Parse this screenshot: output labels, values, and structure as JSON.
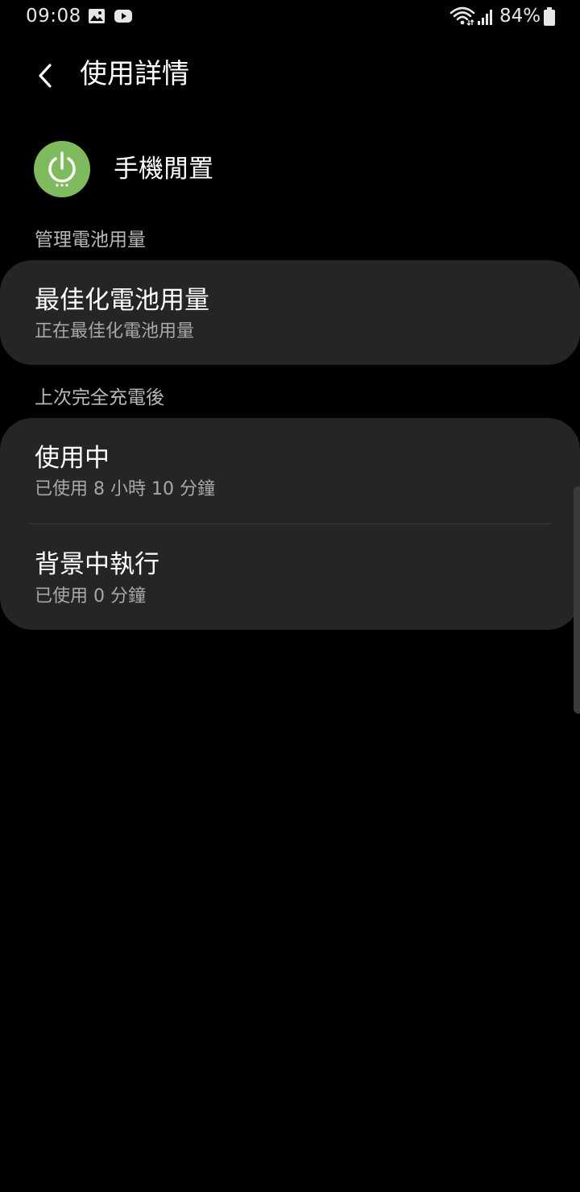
{
  "status_bar": {
    "time": "09:08",
    "notification_icons": [
      "image-icon",
      "youtube-icon"
    ],
    "wifi_icon": "wifi-icon",
    "signal_icon": "signal-icon",
    "battery_percent": "84%",
    "battery_icon": "battery-icon"
  },
  "header": {
    "back_icon": "chevron-left-icon",
    "title": "使用詳情"
  },
  "app": {
    "icon": "power-icon",
    "icon_color": "#7fbb5e",
    "name": "手機閒置"
  },
  "sections": [
    {
      "label": "管理電池用量",
      "items": [
        {
          "title": "最佳化電池用量",
          "subtitle": "正在最佳化電池用量"
        }
      ]
    },
    {
      "label": "上次完全充電後",
      "items": [
        {
          "title": "使用中",
          "subtitle": "已使用 8 小時 10 分鐘"
        },
        {
          "title": "背景中執行",
          "subtitle": "已使用 0 分鐘"
        }
      ]
    }
  ],
  "colors": {
    "background": "#000000",
    "card": "#252525",
    "section_label": "#b8b8b8",
    "subtitle": "#a8a8a8"
  }
}
